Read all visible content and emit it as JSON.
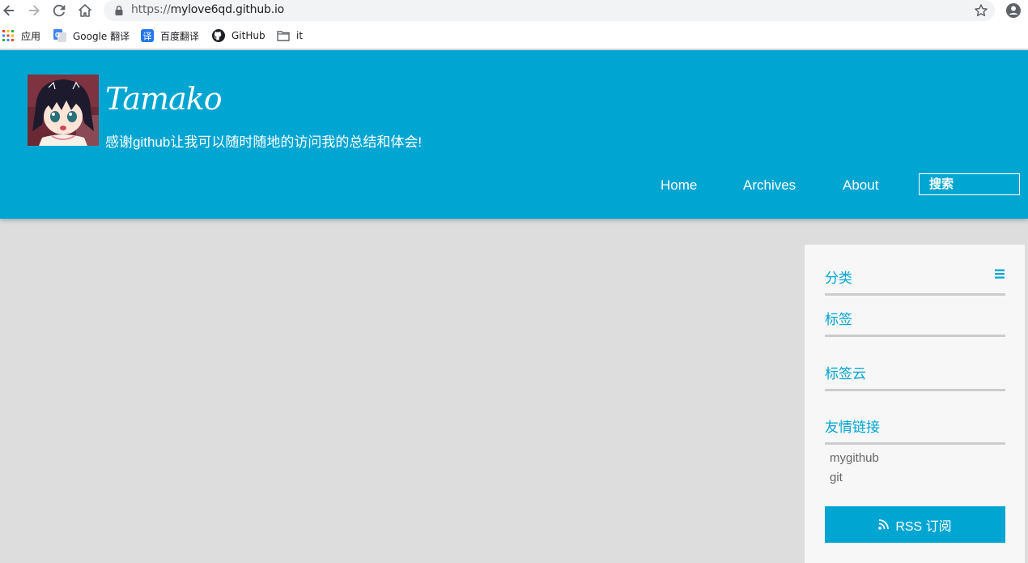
{
  "browser": {
    "url_scheme": "https://",
    "url_host": "mylove6qd.github.io",
    "bookmarks": [
      {
        "label": "应用",
        "icon": "apps-grid-icon"
      },
      {
        "label": "Google 翻译",
        "icon": "google-translate-icon"
      },
      {
        "label": "百度翻译",
        "icon": "baidu-translate-icon"
      },
      {
        "label": "GitHub",
        "icon": "github-icon"
      },
      {
        "label": "it",
        "icon": "folder-icon"
      }
    ]
  },
  "header": {
    "title": "Tamako",
    "subtitle": "感谢github让我可以随时随地的访问我的总结和体会!",
    "nav": [
      "Home",
      "Archives",
      "About"
    ],
    "search_placeholder": "搜索",
    "background_color": "#00a5d2"
  },
  "sidebar": {
    "widgets": {
      "categories": "分类",
      "tags": "标签",
      "tag_cloud": "标签云",
      "friend_links": "友情链接"
    },
    "links": [
      "mygithub",
      "git"
    ],
    "rss_label": "RSS 订阅"
  }
}
